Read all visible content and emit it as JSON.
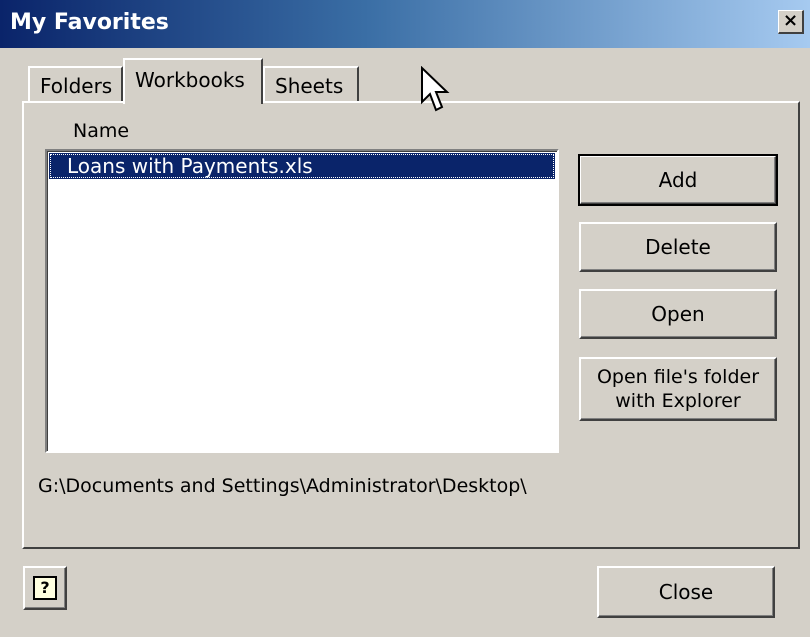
{
  "window": {
    "title": "My Favorites",
    "close_glyph": "×"
  },
  "tabs": [
    {
      "label": "Folders",
      "active": false
    },
    {
      "label": "Workbooks",
      "active": true
    },
    {
      "label": "Sheets",
      "active": false
    }
  ],
  "list": {
    "column_header": "Name",
    "items": [
      {
        "label": "Loans with Payments.xls",
        "selected": true
      }
    ]
  },
  "buttons": {
    "add": "Add",
    "delete": "Delete",
    "open": "Open",
    "open_folder_line1": "Open file's folder",
    "open_folder_line2": "with Explorer",
    "close": "Close",
    "help_glyph": "?"
  },
  "path": "G:\\Documents and Settings\\Administrator\\Desktop\\",
  "icons": {
    "help": "help-question-icon",
    "cursor": "mouse-pointer-icon"
  },
  "colors": {
    "title_gradient_start": "#0a246a",
    "title_gradient_end": "#a6caf0",
    "selection": "#0a246a",
    "face": "#d4d0c8"
  }
}
